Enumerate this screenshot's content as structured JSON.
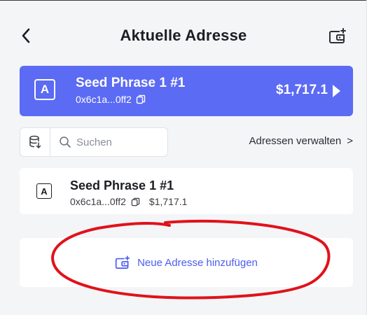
{
  "header": {
    "title": "Aktuelle Adresse",
    "back_icon": "chevron-left-icon",
    "add_icon": "add-wallet-icon"
  },
  "current_address": {
    "avatar_letter": "A",
    "name": "Seed Phrase 1 #1",
    "address": "0x6c1a...0ff2",
    "balance": "$1,717.1",
    "copy_icon": "copy-icon",
    "arrow_icon": "play-arrow-icon",
    "background_color": "#5b6bf3"
  },
  "toolbar": {
    "db_icon": "database-icon",
    "search_icon": "search-icon",
    "search_placeholder": "Suchen",
    "search_value": "",
    "manage_label": "Adressen verwalten",
    "manage_chevron": ">"
  },
  "address_list": [
    {
      "avatar_letter": "A",
      "name": "Seed Phrase 1 #1",
      "address": "0x6c1a...0ff2",
      "balance": "$1,717.1"
    }
  ],
  "add_address": {
    "label": "Neue Adresse hinzufügen",
    "icon": "add-wallet-icon",
    "color": "#4b5cf0"
  },
  "annotation": {
    "type": "hand-drawn ellipse",
    "color": "#e0121b"
  }
}
